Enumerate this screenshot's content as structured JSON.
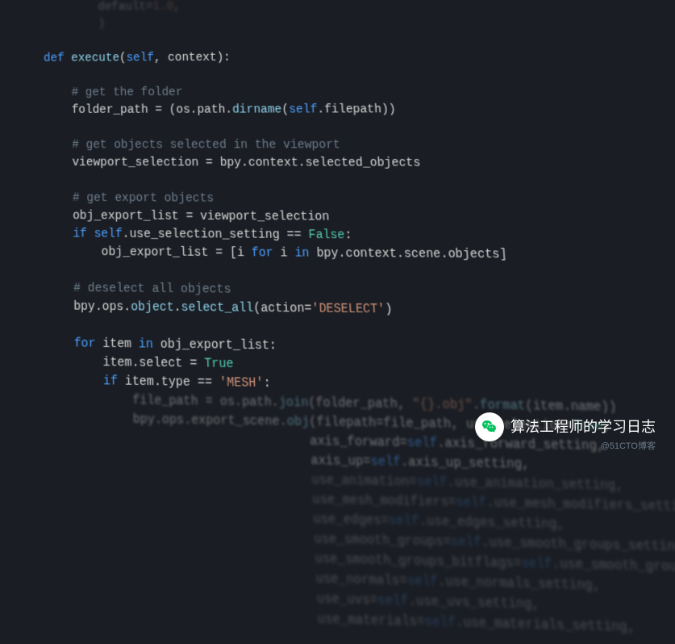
{
  "code": {
    "l0a": "            default=1.0,",
    "l0b": "            )",
    "l1": "    def execute(self, context):",
    "l2": "",
    "l3": "        # get the folder",
    "l4": "        folder_path = (os.path.dirname(self.filepath))",
    "l5": "",
    "l6": "        # get objects selected in the viewport",
    "l7": "        viewport_selection = bpy.context.selected_objects",
    "l8": "",
    "l9": "        # get export objects",
    "l10": "        obj_export_list = viewport_selection",
    "l11": "        if self.use_selection_setting == False:",
    "l12": "            obj_export_list = [i for i in bpy.context.scene.objects]",
    "l13": "",
    "l14": "        # deselect all objects",
    "l15": "        bpy.ops.object.select_all(action='DESELECT')",
    "l16": "",
    "l17": "        for item in obj_export_list:",
    "l18": "            item.select = True",
    "l19": "            if item.type == 'MESH':",
    "l20": "                file_path = os.path.join(folder_path, \"{}.obj\".format(item.name))",
    "l21": "                bpy.ops.export_scene.obj(filepath=file_path, use_selection=True,",
    "l22": "                                        axis_forward=self.axis_forward_setting,",
    "l23": "                                        axis_up=self.axis_up_setting,",
    "l24": "                                        use_animation=self.use_animation_setting,",
    "l25": "                                        use_mesh_modifiers=self.use_mesh_modifiers_setting,",
    "l26": "                                        use_edges=self.use_edges_setting,",
    "l27": "                                        use_smooth_groups=self.use_smooth_groups_setting,",
    "l28": "                                        use_smooth_groups_bitflags=self.use_smooth_groups_bitflags_setting,",
    "l29": "                                        use_normals=self.use_normals_setting,",
    "l30": "                                        use_uvs=self.use_uvs_setting,",
    "l31": "                                        use_materials=self.use_materials_setting,"
  },
  "watermark": {
    "text": "算法工程师的学习日志",
    "sub": "@51CTO博客"
  }
}
